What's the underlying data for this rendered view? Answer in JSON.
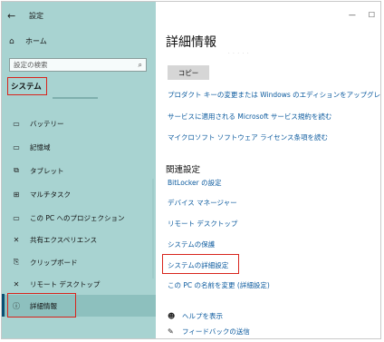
{
  "window": {
    "back_glyph": "←",
    "title": "設定",
    "minimize_glyph": "—",
    "maximize_glyph": "☐"
  },
  "sidebar": {
    "home_label": "ホーム",
    "search_placeholder": "設定の検索",
    "section_label": "システム",
    "items": [
      {
        "label": "バッテリー",
        "icon": "battery-icon",
        "glyph": "▭"
      },
      {
        "label": "記憶域",
        "icon": "storage-icon",
        "glyph": "▭"
      },
      {
        "label": "タブレット",
        "icon": "tablet-icon",
        "glyph": "⧉"
      },
      {
        "label": "マルチタスク",
        "icon": "multitask-icon",
        "glyph": "⊞"
      },
      {
        "label": "この PC へのプロジェクション",
        "icon": "projection-icon",
        "glyph": "▭"
      },
      {
        "label": "共有エクスペリエンス",
        "icon": "shared-experience-icon",
        "glyph": "✕"
      },
      {
        "label": "クリップボード",
        "icon": "clipboard-icon",
        "glyph": "⎘"
      },
      {
        "label": "リモート デスクトップ",
        "icon": "remote-desktop-icon",
        "glyph": "✕"
      },
      {
        "label": "詳細情報",
        "icon": "info-icon",
        "glyph": "ⓘ",
        "selected": true
      }
    ]
  },
  "main": {
    "title": "詳細情報",
    "copy_button": "コピー",
    "links": [
      "プロダクト キーの変更または Windows のエディションをアップグレード",
      "サービスに適用される Microsoft サービス規約を読む",
      "マイクロソフト ソフトウェア ライセンス条項を読む"
    ],
    "related_title": "関連設定",
    "related_links": [
      "BitLocker の設定",
      "デバイス マネージャー",
      "リモート デスクトップ",
      "システムの保護",
      "システムの詳細設定",
      "この PC の名前を変更 (詳細設定)"
    ],
    "help_label": "ヘルプを表示",
    "feedback_label": "フィードバックの送信"
  },
  "colors": {
    "sidebar_bg": "#a8d3d1",
    "link": "#0b5a9e",
    "highlight_box": "#d8241c"
  }
}
